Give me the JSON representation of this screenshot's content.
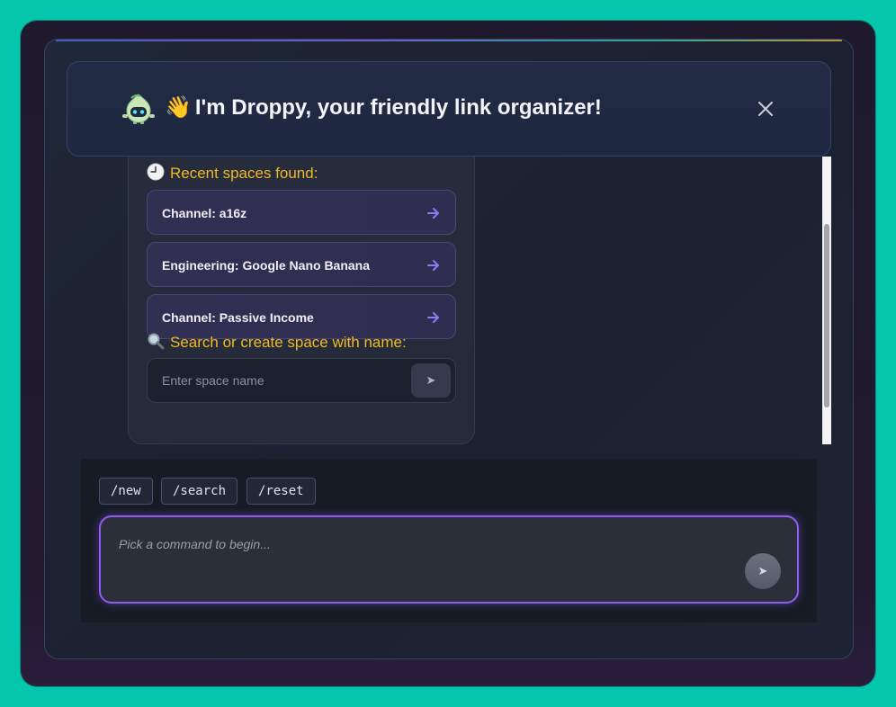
{
  "header": {
    "wave_emoji": "👋",
    "title": "I'm Droppy, your friendly link organizer!",
    "mascot_icon": "robot-droplet-mascot",
    "close_icon": "close-icon"
  },
  "recent": {
    "label_emoji": "clock-icon",
    "label": "Recent spaces found:",
    "items": [
      {
        "label": "Channel: a16z"
      },
      {
        "label": "Engineering: Google Nano Banana"
      },
      {
        "label": "Channel: Passive Income"
      }
    ],
    "item_arrow_icon": "arrow-right-icon"
  },
  "search": {
    "label_emoji": "magnifier-icon",
    "label": "Search or create space with name:",
    "placeholder": "Enter space name",
    "send_glyph": "➤"
  },
  "commands": [
    "/new",
    "/search",
    "/reset"
  ],
  "composer": {
    "placeholder": "Pick a command to begin...",
    "send_glyph": "➤"
  },
  "colors": {
    "background": "#04c6ad",
    "accent_purple": "#8d5cf0",
    "label_gold": "#f0b927",
    "arrow_purple": "#8a7cf5"
  }
}
